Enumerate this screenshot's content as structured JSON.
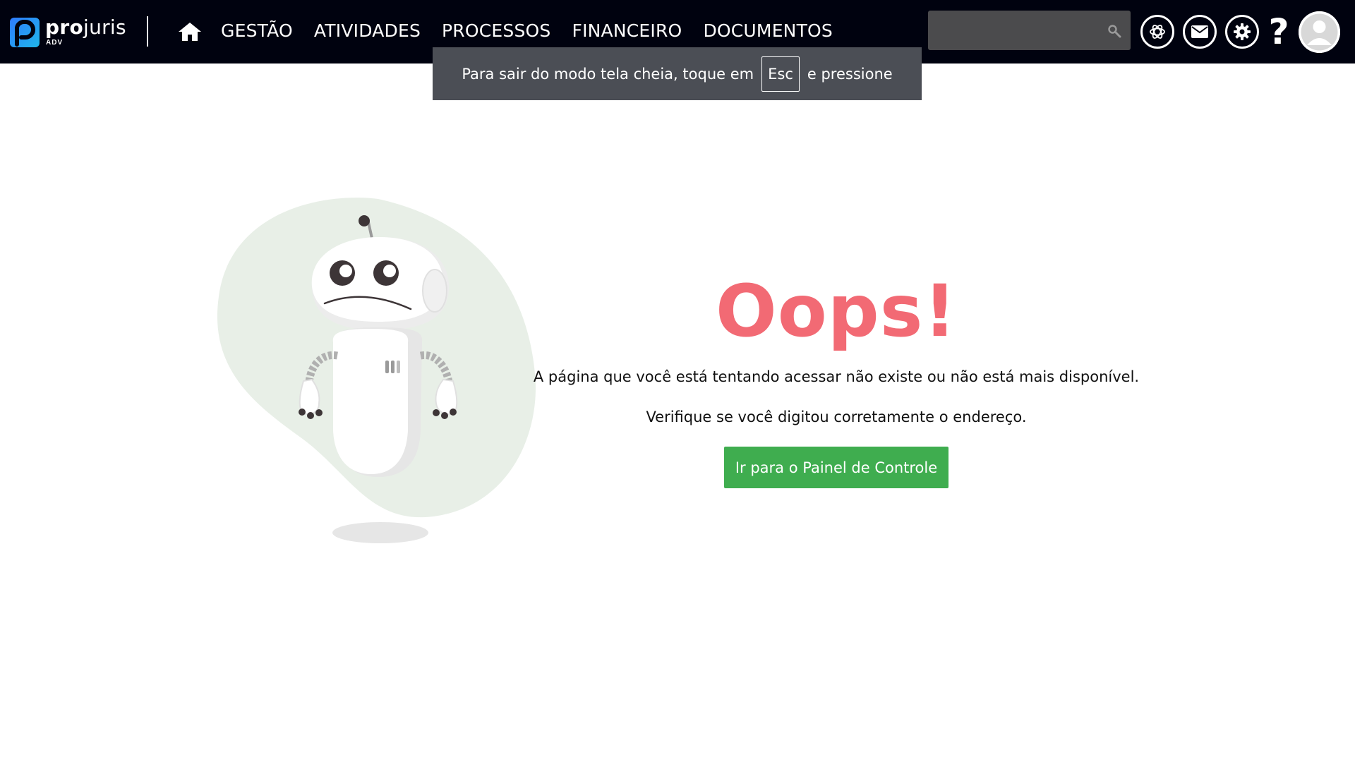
{
  "app": {
    "logo_bold": "pro",
    "logo_light": "juris",
    "logo_sub": "ADV"
  },
  "nav": {
    "home_icon": "home-icon",
    "items": [
      {
        "label": "GESTÃO"
      },
      {
        "label": "ATIVIDADES"
      },
      {
        "label": "PROCESSOS"
      },
      {
        "label": "FINANCEIRO"
      },
      {
        "label": "DOCUMENTOS"
      }
    ]
  },
  "search": {
    "value": "",
    "placeholder": "",
    "icon": "search-icon"
  },
  "toolbar": {
    "ai_icon": "ai-assistant-icon",
    "mail_icon": "mail-icon",
    "settings_icon": "gear-icon",
    "help_label": "?",
    "avatar_icon": "user-avatar-icon"
  },
  "fullscreen_notice": {
    "before": "Para sair do modo tela cheia, toque em",
    "key": "Esc",
    "after": "e pressione"
  },
  "error": {
    "title": "Oops!",
    "message1": "A página que você está tentando acessar não existe ou não está mais disponível.",
    "message2": "Verifique se você digitou corretamente o endereço.",
    "button_label": "Ir para o Painel de Controle"
  },
  "colors": {
    "topbar": "#00020f",
    "accent_title": "#f26a74",
    "button": "#3fad4f",
    "toast": "#4b4e55",
    "blob": "#e8efe7"
  }
}
